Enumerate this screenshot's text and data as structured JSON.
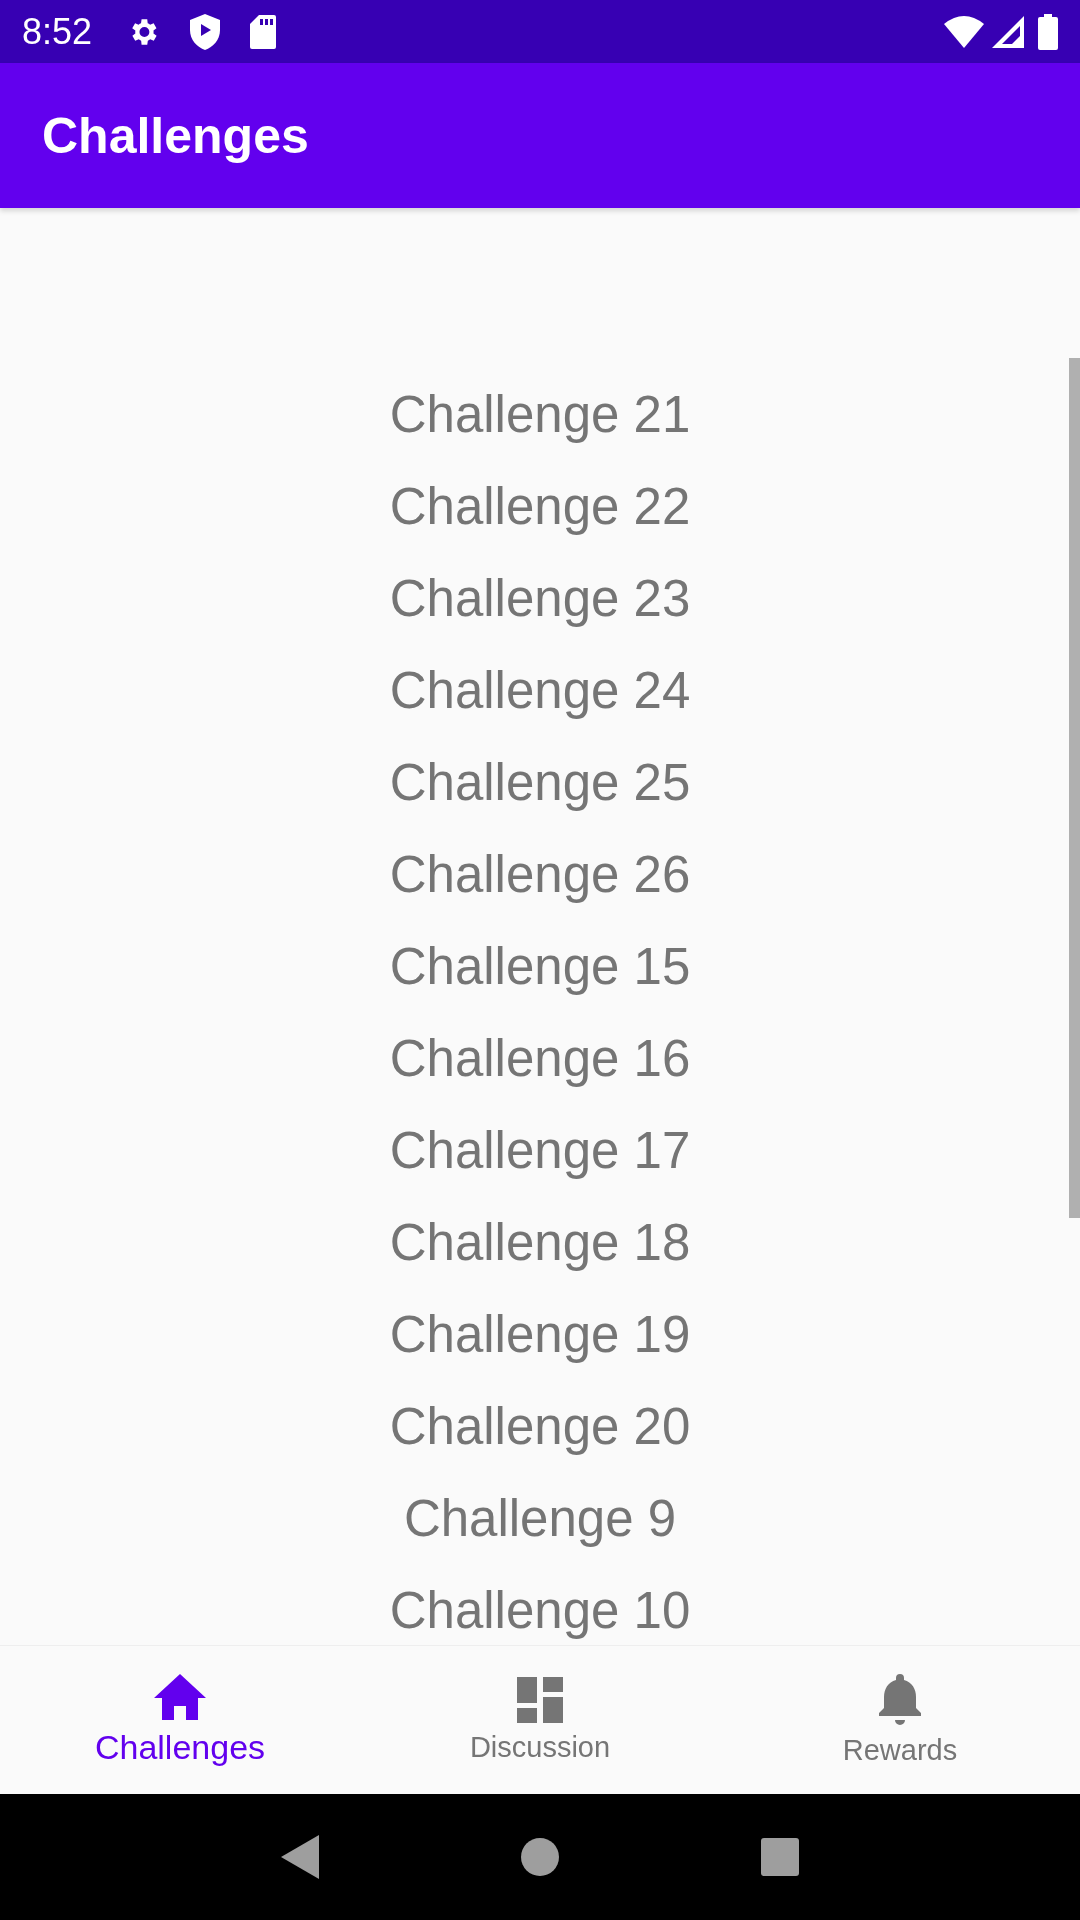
{
  "status_bar": {
    "time": "8:52"
  },
  "app_bar": {
    "title": "Challenges"
  },
  "challenges": [
    "Challenge 21",
    "Challenge 22",
    "Challenge 23",
    "Challenge 24",
    "Challenge 25",
    "Challenge 26",
    "Challenge 15",
    "Challenge 16",
    "Challenge 17",
    "Challenge 18",
    "Challenge 19",
    "Challenge 20",
    "Challenge 9",
    "Challenge 10"
  ],
  "bottom_nav": [
    {
      "label": "Challenges",
      "kind": "home",
      "selected": true
    },
    {
      "label": "Discussion",
      "kind": "dashboard",
      "selected": false
    },
    {
      "label": "Rewards",
      "kind": "bell",
      "selected": false
    }
  ]
}
